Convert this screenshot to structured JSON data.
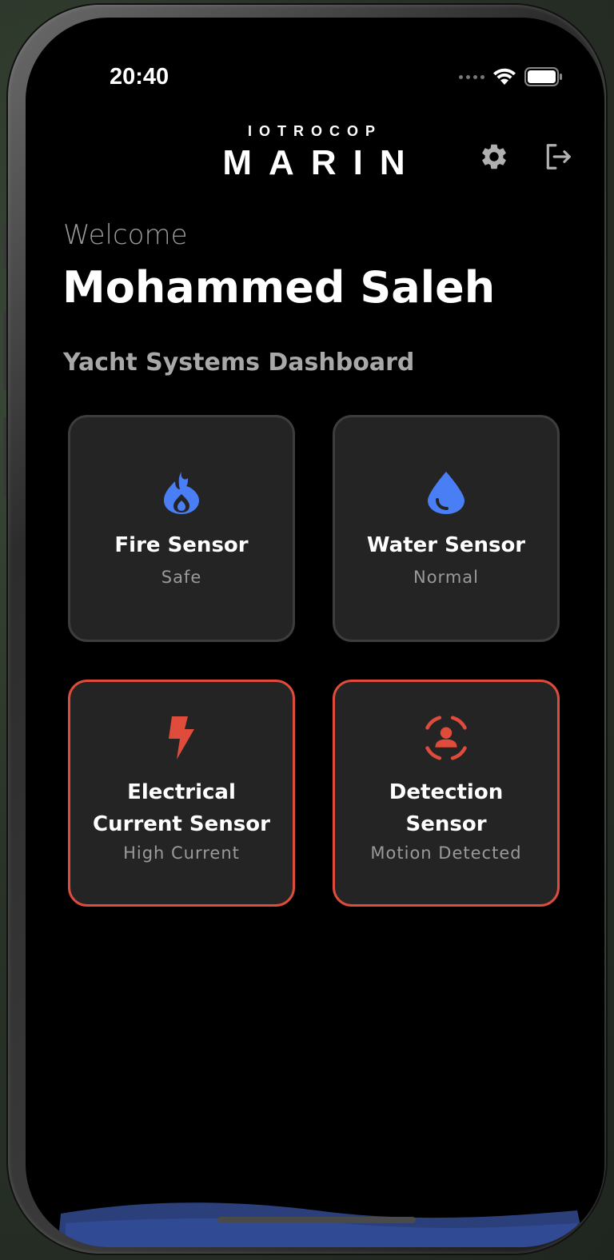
{
  "status_bar": {
    "time": "20:40"
  },
  "header": {
    "brand_top": "IOTROCOP",
    "brand_main": "MARIN",
    "settings_icon": "gear-icon",
    "logout_icon": "logout-icon"
  },
  "greeting": {
    "welcome": "Welcome",
    "name": "Mohammed Saleh"
  },
  "dashboard": {
    "title": "Yacht Systems Dashboard",
    "sensors": [
      {
        "title": "Fire Sensor",
        "status": "Safe",
        "icon": "flame-icon",
        "state": "normal",
        "color": "#4a7ef5"
      },
      {
        "title": "Water Sensor",
        "status": "Normal",
        "icon": "water-drop-icon",
        "state": "normal",
        "color": "#4a7ef5"
      },
      {
        "title": "Electrical Current Sensor",
        "status": "High Current",
        "icon": "lightning-icon",
        "state": "alert",
        "color": "#e04c3c"
      },
      {
        "title": "Detection Sensor",
        "status": "Motion Detected",
        "icon": "person-scan-icon",
        "state": "alert",
        "color": "#e04c3c"
      }
    ]
  },
  "colors": {
    "background": "#000000",
    "card": "#242424",
    "card_border": "#3d3d3d",
    "alert": "#e04c3c",
    "accent": "#4a7ef5"
  }
}
